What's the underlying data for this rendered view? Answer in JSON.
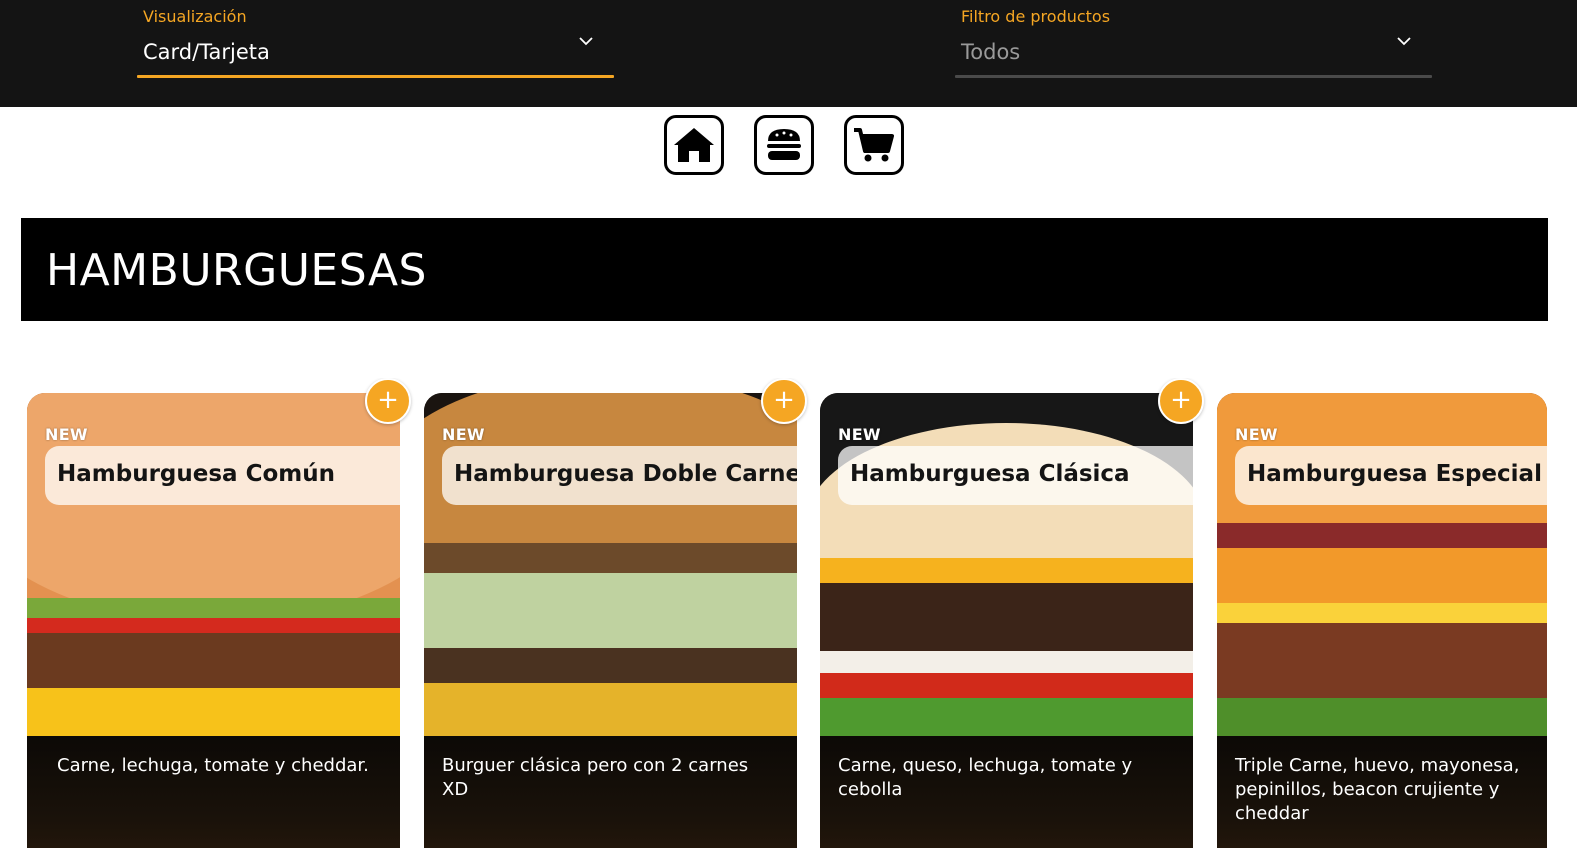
{
  "filters": {
    "visualization": {
      "label": "Visualización",
      "value": "Card/Tarjeta"
    },
    "product_filter": {
      "label": "Filtro de productos",
      "value": "Todos"
    }
  },
  "nav": {
    "icons": [
      "home-icon",
      "burger-icon",
      "cart-icon"
    ]
  },
  "section": {
    "title": "HAMBURGUESAS"
  },
  "colors": {
    "accent": "#f5a623",
    "topbar": "#141414",
    "section_bg": "#000000"
  },
  "add_label": "+",
  "products": [
    {
      "badge": "NEW",
      "name": "Hamburguesa Común",
      "description": "Carne, lechuga, tomate y cheddar."
    },
    {
      "badge": "NEW",
      "name": "Hamburguesa Doble Carne",
      "description": "Burguer clásica pero con 2 carnes XD"
    },
    {
      "badge": "NEW",
      "name": "Hamburguesa Clásica",
      "description": "Carne, queso, lechuga, tomate y cebolla"
    },
    {
      "badge": "NEW",
      "name": "Hamburguesa Especial",
      "description": "Triple Carne, huevo, mayonesa, pepinillos, beacon crujiente y cheddar"
    }
  ]
}
